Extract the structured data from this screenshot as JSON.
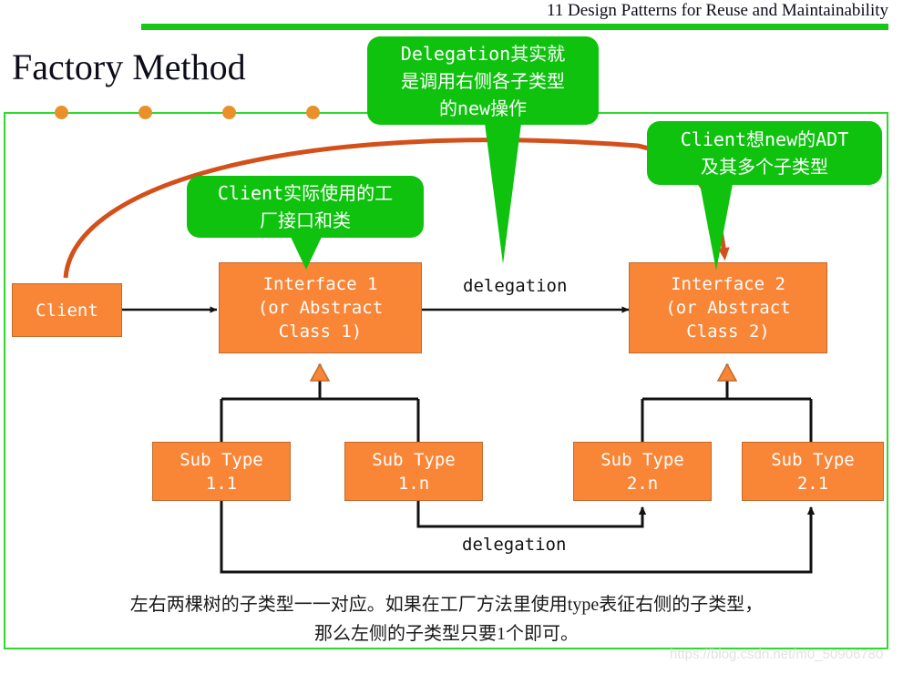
{
  "header": {
    "title": "11 Design Patterns for Reuse and Maintainability"
  },
  "slide": {
    "title": "Factory Method"
  },
  "callouts": [
    {
      "id": "delegation-note",
      "lines": [
        "Delegation其实就",
        "是调用右侧各子类型",
        "的new操作"
      ]
    },
    {
      "id": "client-adt-note",
      "lines": [
        "Client想new的ADT",
        "及其多个子类型"
      ]
    },
    {
      "id": "client-factory-note",
      "lines": [
        "Client实际使用的工",
        "厂接口和类"
      ]
    }
  ],
  "nodes": [
    {
      "id": "client",
      "lines": [
        "Client"
      ]
    },
    {
      "id": "interface-1",
      "lines": [
        "Interface 1",
        "(or Abstract",
        "Class 1)"
      ]
    },
    {
      "id": "interface-2",
      "lines": [
        "Interface 2",
        "(or Abstract",
        "Class 2)"
      ]
    },
    {
      "id": "sub-type-1-1",
      "lines": [
        "Sub Type",
        "1.1"
      ]
    },
    {
      "id": "sub-type-1-n",
      "lines": [
        "Sub Type",
        "1.n"
      ]
    },
    {
      "id": "sub-type-2-n",
      "lines": [
        "Sub Type",
        "2.n"
      ]
    },
    {
      "id": "sub-type-2-1",
      "lines": [
        "Sub Type",
        "2.1"
      ]
    }
  ],
  "edge_labels": {
    "delegation_top": "delegation",
    "delegation_bottom": "delegation"
  },
  "caption": {
    "line1": "左右两棵树的子类型一一对应。如果在工厂方法里使用type表征右侧的子类型，",
    "line2": "那么左侧的子类型只要1个即可。"
  },
  "watermark": {
    "text": "https://blog.csdn.net/m0_50906780"
  },
  "colors": {
    "green_accent": "#14c814",
    "green_callout": "#0ec20e",
    "orange_node": "#f98537",
    "orange_dot": "#e8912a",
    "orange_arrow": "#d4501a",
    "frame_green": "#2ddb2d",
    "black_wire": "#111111"
  }
}
